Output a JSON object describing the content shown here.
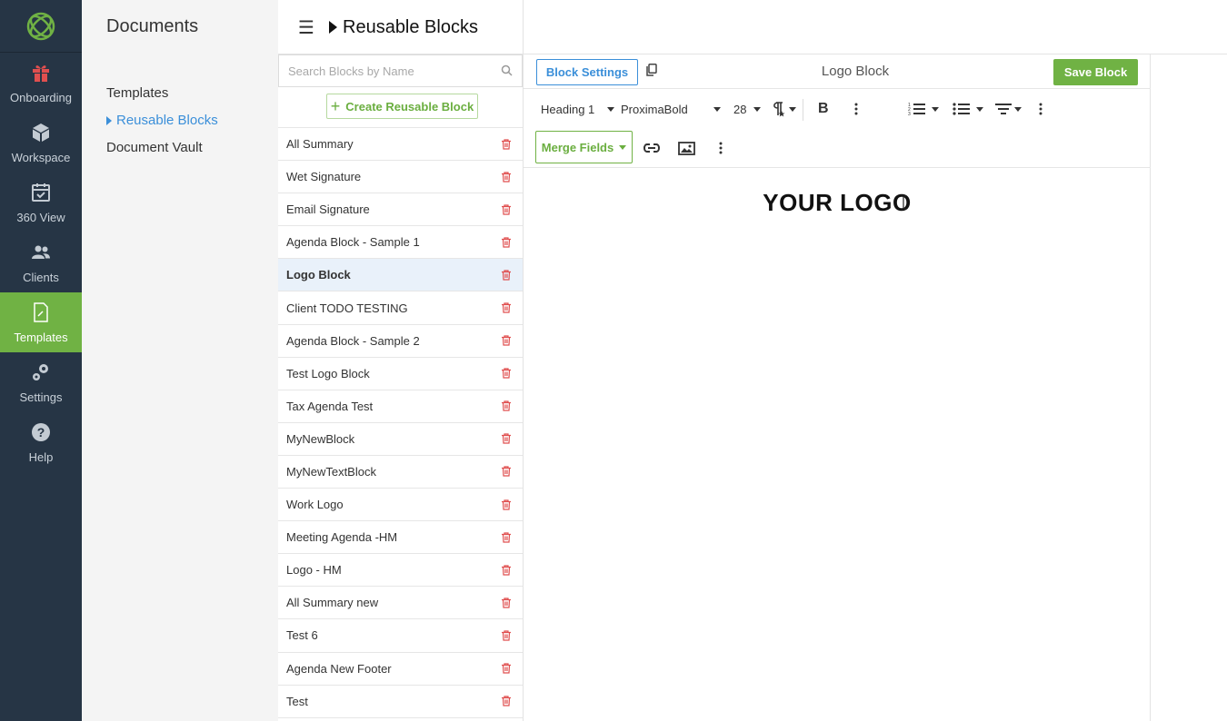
{
  "nav": {
    "items": [
      {
        "label": "Onboarding",
        "icon": "gift-icon"
      },
      {
        "label": "Workspace",
        "icon": "cube-icon"
      },
      {
        "label": "360 View",
        "icon": "calendar-check-icon"
      },
      {
        "label": "Clients",
        "icon": "users-icon"
      },
      {
        "label": "Templates",
        "icon": "document-edit-icon",
        "active": true
      },
      {
        "label": "Settings",
        "icon": "gears-icon"
      },
      {
        "label": "Help",
        "icon": "help-circle-icon"
      }
    ],
    "active_color": "#70b244",
    "background": "#263545"
  },
  "documents": {
    "title": "Documents",
    "menu": [
      {
        "label": "Templates"
      },
      {
        "label": "Reusable Blocks",
        "active": true
      },
      {
        "label": "Document Vault"
      }
    ]
  },
  "header": {
    "title": "Reusable Blocks"
  },
  "blocks": {
    "search_placeholder": "Search Blocks by Name",
    "create_label": "Create Reusable Block",
    "items": [
      "All Summary",
      "Wet Signature",
      "Email Signature",
      "Agenda Block - Sample 1",
      "Logo Block",
      "Client TODO TESTING",
      "Agenda Block - Sample 2",
      "Test Logo Block",
      "Tax Agenda Test",
      "MyNewBlock",
      "MyNewTextBlock",
      "Work Logo",
      "Meeting Agenda -HM",
      "Logo - HM",
      "All Summary new",
      "Test 6",
      "Agenda New Footer",
      "Test"
    ],
    "selected": "Logo Block"
  },
  "editor": {
    "settings_label": "Block Settings",
    "block_name": "Logo Block",
    "save_label": "Save Block",
    "toolbar": {
      "style": "Heading 1",
      "font": "ProximaBold",
      "size": "28",
      "bold": "B"
    },
    "merge_label": "Merge Fields",
    "content_heading": "YOUR LOGO"
  },
  "colors": {
    "accent_green": "#70b244",
    "accent_blue": "#3b8fd9",
    "delete_red": "#e04f4f"
  }
}
